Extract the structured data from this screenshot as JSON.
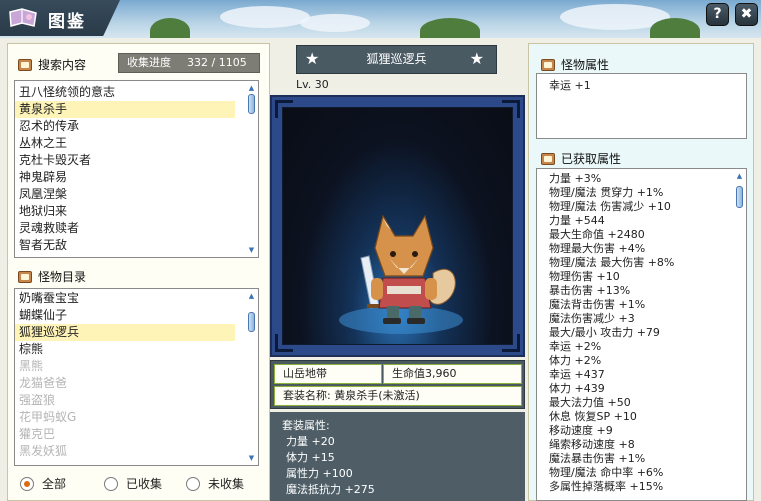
{
  "window": {
    "title": "图鉴",
    "help_label": "?",
    "close_label": "✖"
  },
  "left": {
    "search_title": "搜索内容",
    "progress_label": "收集进度",
    "progress_value": "332 / 1105",
    "search_items": [
      {
        "label": "丑八怪统领的意志",
        "selected": false
      },
      {
        "label": "黄泉杀手",
        "selected": true
      },
      {
        "label": "忍术的传承",
        "selected": false
      },
      {
        "label": "丛林之王",
        "selected": false
      },
      {
        "label": "克杜卡毁灭者",
        "selected": false
      },
      {
        "label": "神鬼辟易",
        "selected": false
      },
      {
        "label": "凤凰涅槃",
        "selected": false
      },
      {
        "label": "地狱归来",
        "selected": false
      },
      {
        "label": "灵魂救赎者",
        "selected": false
      },
      {
        "label": "智者无敌",
        "selected": false
      }
    ],
    "catalog_title": "怪物目录",
    "catalog_items": [
      {
        "label": "奶嘴蚕宝宝",
        "selected": false,
        "collected": true
      },
      {
        "label": "蝴蝶仙子",
        "selected": false,
        "collected": true
      },
      {
        "label": "狐狸巡逻兵",
        "selected": true,
        "collected": true
      },
      {
        "label": "棕熊",
        "selected": false,
        "collected": true
      },
      {
        "label": "黑熊",
        "selected": false,
        "collected": false
      },
      {
        "label": "龙猫爸爸",
        "selected": false,
        "collected": false
      },
      {
        "label": "强盗狼",
        "selected": false,
        "collected": false
      },
      {
        "label": "花甲蚂蚁G",
        "selected": false,
        "collected": false
      },
      {
        "label": "獾克巴",
        "selected": false,
        "collected": false
      },
      {
        "label": "黑发妖狐",
        "selected": false,
        "collected": false
      }
    ],
    "filters": [
      {
        "label": "全部",
        "checked": true
      },
      {
        "label": "已收集",
        "checked": false
      },
      {
        "label": "未收集",
        "checked": false
      }
    ]
  },
  "center": {
    "monster_name": "狐狸巡逻兵",
    "level": "Lv.  30",
    "region": "山岳地带",
    "hp": "生命值3,960",
    "set_name": "套装名称:  黄泉杀手(未激活)",
    "set_attr_title": "套装属性:",
    "set_attrs": [
      "力量 +20",
      "体力 +15",
      "属性力 +100",
      "魔法抵抗力 +275"
    ]
  },
  "right": {
    "monster_attr_title": "怪物属性",
    "monster_attrs": [
      "幸运 +1"
    ],
    "acquired_title": "已获取属性",
    "acquired_attrs": [
      "力量 +3%",
      "物理/魔法 贯穿力 +1%",
      "物理/魔法 伤害减少 +10",
      "力量 +544",
      "最大生命值 +2480",
      "物理最大伤害 +4%",
      "物理/魔法 最大伤害 +8%",
      "物理伤害 +10",
      "暴击伤害 +13%",
      "魔法背击伤害 +1%",
      "魔法伤害减少 +3",
      "最大/最小 攻击力 +79",
      "幸运 +2%",
      "体力 +2%",
      "幸运 +437",
      "体力 +439",
      "最大法力值 +50",
      "休息 恢复SP +10",
      "移动速度 +9",
      "绳索移动速度 +8",
      "魔法暴击伤害 +1%",
      "物理/魔法 命中率 +6%",
      "多属性掉落概率 +15%"
    ]
  },
  "colors": {
    "accent": "#d96b16",
    "selected_row": "#fff4b8",
    "panel_dark": "#4a5a63",
    "stage_border": "#2c4a8a"
  }
}
